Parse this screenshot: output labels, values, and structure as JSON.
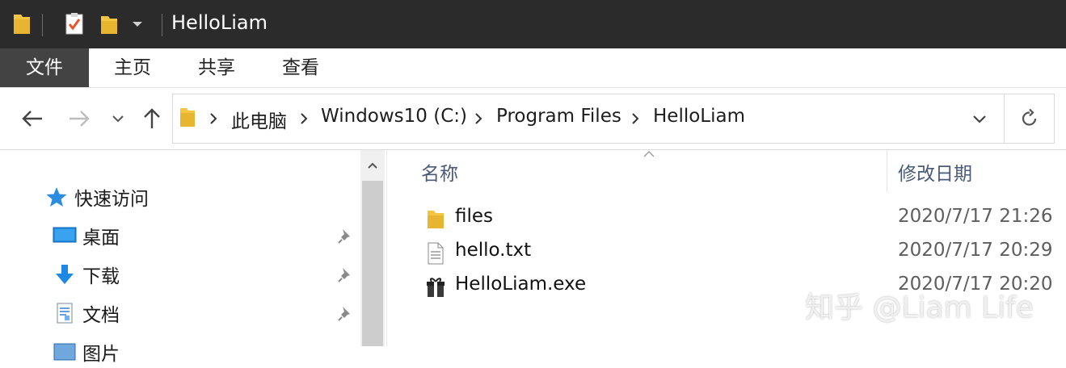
{
  "window": {
    "title": "HelloLiam"
  },
  "ribbon": {
    "tabs": [
      "文件",
      "主页",
      "共享",
      "查看"
    ]
  },
  "address": {
    "crumbs": [
      "此电脑",
      "Windows10 (C:)",
      "Program Files",
      "HelloLiam"
    ]
  },
  "nav": {
    "quick_access": "快速访问",
    "items": [
      {
        "label": "桌面",
        "icon": "desktop-icon"
      },
      {
        "label": "下载",
        "icon": "download-icon"
      },
      {
        "label": "文档",
        "icon": "document-icon"
      },
      {
        "label": "图片",
        "icon": "picture-icon"
      }
    ]
  },
  "content": {
    "columns": {
      "name": "名称",
      "modified": "修改日期"
    },
    "files": [
      {
        "name": "files",
        "modified": "2020/7/17 21:26",
        "icon": "folder-icon"
      },
      {
        "name": "hello.txt",
        "modified": "2020/7/17 20:29",
        "icon": "text-file-icon"
      },
      {
        "name": "HelloLiam.exe",
        "modified": "2020/7/17 20:20",
        "icon": "exe-icon"
      }
    ]
  },
  "watermark": "知乎 @Liam Life",
  "colors": {
    "titlebar": "#2b2b2b",
    "file_tab": "#434343",
    "folder": "#f5c542",
    "accent_blue": "#1e88e5"
  }
}
